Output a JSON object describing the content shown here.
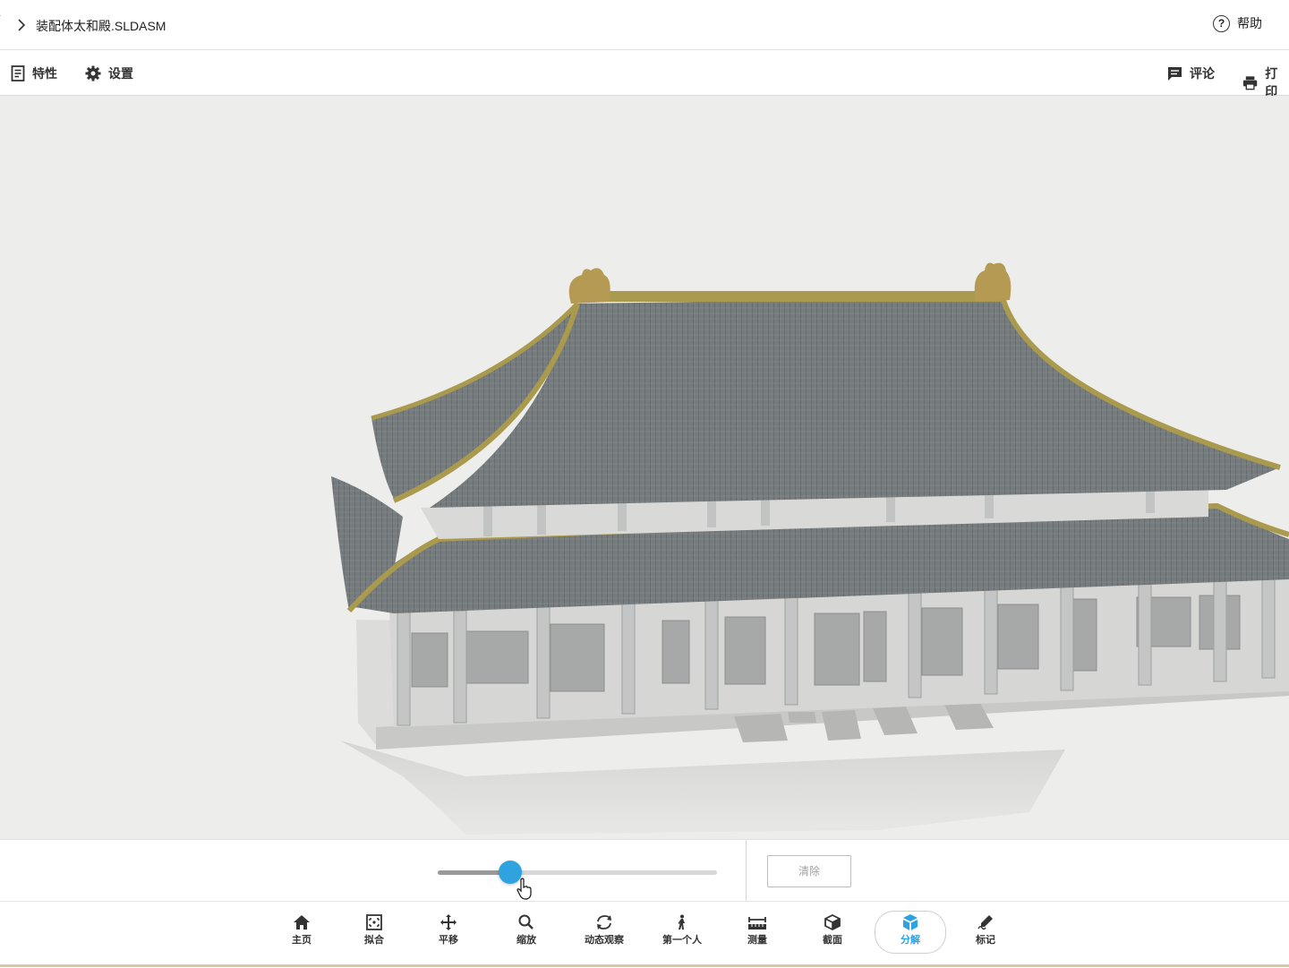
{
  "titlebar": {
    "back_mark": "˙",
    "filename": "装配体太和殿.SLDASM",
    "help_label": "帮助"
  },
  "toolbar": {
    "properties_label": "特性",
    "settings_label": "设置",
    "comment_label": "评论",
    "print_label": "打印"
  },
  "explode": {
    "value": 0.26,
    "clear_label": "清除"
  },
  "nav": {
    "home": "主页",
    "fit": "拟合",
    "pan": "平移",
    "zoom": "缩放",
    "orbit": "动态观察",
    "first_person": "第一个人",
    "measure": "测量",
    "section": "截面",
    "explode": "分解",
    "markup": "标记",
    "active": "explode"
  },
  "colors": {
    "accent": "#2ea3e0",
    "roof": "#6e7376",
    "gold": "#a99a4e",
    "wall": "#d9d9d7"
  },
  "icons": [
    "chevron-right-icon",
    "help-icon",
    "properties-icon",
    "gear-icon",
    "comment-icon",
    "printer-icon",
    "home-icon",
    "fit-icon",
    "pan-icon",
    "zoom-icon",
    "orbit-icon",
    "walk-icon",
    "measure-icon",
    "section-icon",
    "explode-icon",
    "markup-icon",
    "pointer-icon"
  ]
}
